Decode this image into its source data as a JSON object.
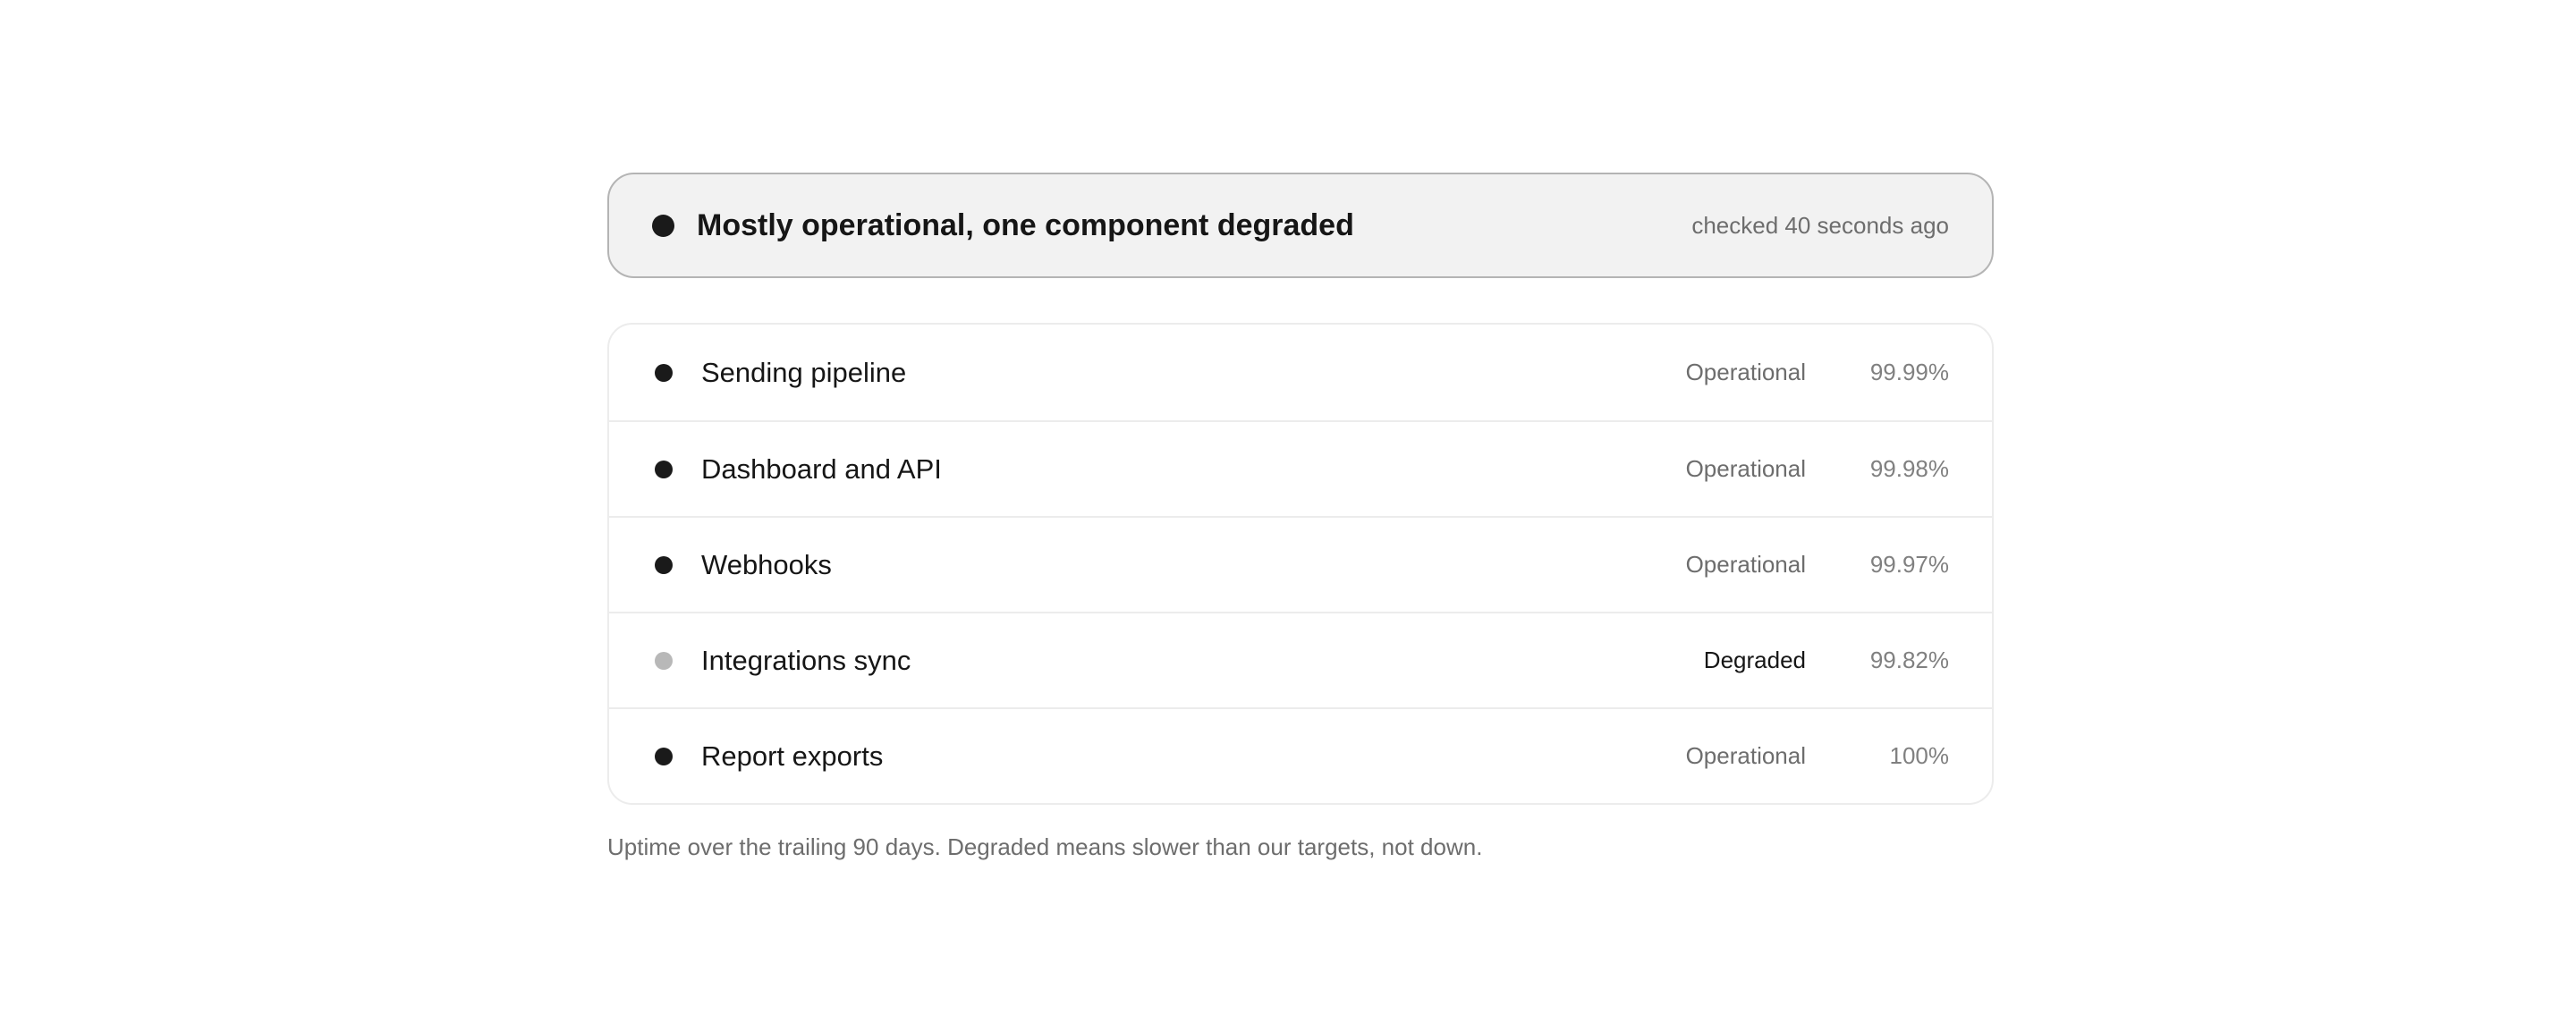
{
  "summary": {
    "title": "Mostly operational, one component degraded",
    "checked": "checked 40 seconds ago"
  },
  "components": [
    {
      "name": "Sending pipeline",
      "status": "Operational",
      "uptime": "99.99%"
    },
    {
      "name": "Dashboard and API",
      "status": "Operational",
      "uptime": "99.98%"
    },
    {
      "name": "Webhooks",
      "status": "Operational",
      "uptime": "99.97%"
    },
    {
      "name": "Integrations sync",
      "status": "Degraded",
      "uptime": "99.82%"
    },
    {
      "name": "Report exports",
      "status": "Operational",
      "uptime": "100%"
    }
  ],
  "footnote": "Uptime over the trailing 90 days. Degraded means slower than our targets, not down.",
  "colors": {
    "operational_dot": "#1a1a1a",
    "degraded_dot": "#b8b8b8",
    "banner_bg": "#f2f2f2"
  }
}
